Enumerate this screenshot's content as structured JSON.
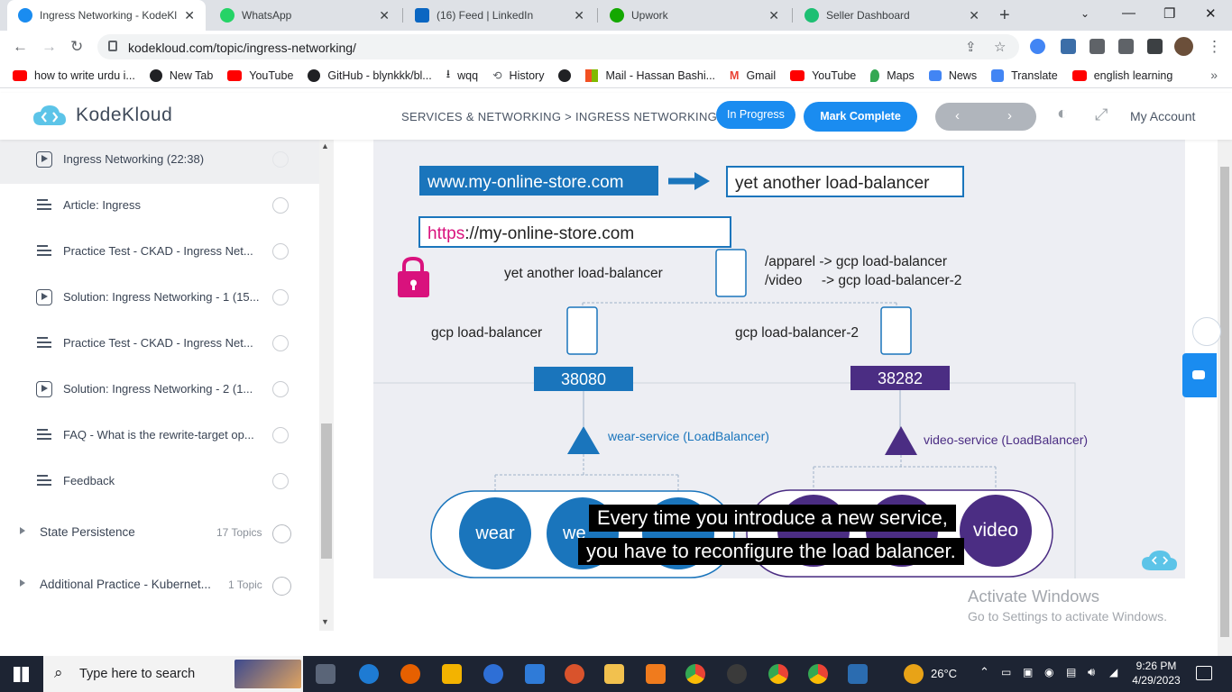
{
  "browser": {
    "tabs": [
      {
        "title": "Ingress Networking - KodeKl",
        "active": true,
        "favicon_color": "#1a8cf0"
      },
      {
        "title": "WhatsApp",
        "active": false,
        "favicon_color": "#25d366"
      },
      {
        "title": "(16) Feed | LinkedIn",
        "active": false,
        "favicon_color": "#0a66c2"
      },
      {
        "title": "Upwork",
        "active": false,
        "favicon_color": "#14a800"
      },
      {
        "title": "Seller Dashboard",
        "active": false,
        "favicon_color": "#1dbf73"
      }
    ],
    "url": "kodekloud.com/topic/ingress-networking/",
    "bookmarks": [
      {
        "label": "how to write urdu i...",
        "color": "#ff0000"
      },
      {
        "label": "New Tab",
        "color": "#202124"
      },
      {
        "label": "YouTube",
        "color": "#ff0000"
      },
      {
        "label": "GitHub - blynkkk/bl...",
        "color": "#202124"
      },
      {
        "label": "wqq",
        "color": "#202124"
      },
      {
        "label": "History",
        "color": "#5f6368"
      },
      {
        "label": "",
        "color": "#202124"
      },
      {
        "label": "Mail - Hassan Bashi...",
        "color": "#f25022"
      },
      {
        "label": "Gmail",
        "color": "#ea4335"
      },
      {
        "label": "YouTube",
        "color": "#ff0000"
      },
      {
        "label": "Maps",
        "color": "#34a853"
      },
      {
        "label": "News",
        "color": "#4285f4"
      },
      {
        "label": "Translate",
        "color": "#4285f4"
      },
      {
        "label": "english learning",
        "color": "#ff0000"
      }
    ]
  },
  "header": {
    "logo": "KodeKloud",
    "breadcrumb": "SERVICES & NETWORKING > INGRESS NETWORKING",
    "status_button": "In Progress",
    "complete_button": "Mark Complete",
    "account": "My Account",
    "accent": "#1a8cf0"
  },
  "sidebar": {
    "lessons": [
      {
        "type": "video",
        "title": "Ingress Networking (22:38)",
        "current": true
      },
      {
        "type": "doc",
        "title": "Article: Ingress",
        "current": false
      },
      {
        "type": "doc",
        "title": "Practice Test - CKAD - Ingress Net...",
        "current": false
      },
      {
        "type": "video",
        "title": "Solution: Ingress Networking - 1 (15...",
        "current": false
      },
      {
        "type": "doc",
        "title": "Practice Test - CKAD - Ingress Net...",
        "current": false
      },
      {
        "type": "video",
        "title": "Solution: Ingress Networking - 2 (1...",
        "current": false
      },
      {
        "type": "doc",
        "title": "FAQ - What is the rewrite-target op...",
        "current": false
      },
      {
        "type": "doc",
        "title": "Feedback",
        "current": false
      }
    ],
    "sections": [
      {
        "title": "State Persistence",
        "count": "17 Topics"
      },
      {
        "title": "Additional Practice - Kubernet...",
        "count": "1 Topic"
      }
    ]
  },
  "video": {
    "url_box": "www.my-online-store.com",
    "lb_box": "yet another load-balancer",
    "https_prefix": "https",
    "https_rest": "://my-online-store.com",
    "lb_label": "yet another load-balancer",
    "rule1": "/apparel -> gcp load-balancer",
    "rule2": "/video     -> gcp load-balancer-2",
    "gcp1": "gcp load-balancer",
    "gcp2": "gcp load-balancer-2",
    "port1": "38080",
    "port2": "38282",
    "svc1": "wear-service (LoadBalancer)",
    "svc2": "video-service (LoadBalancer)",
    "pod_wear": "wear",
    "pod_wear2": "we",
    "pod_video": "video",
    "subtitle_line1": "Every time you introduce a new service,",
    "subtitle_line2": "you have to reconfigure the load balancer.",
    "colors": {
      "blue": "#1a75bc",
      "purple": "#4b2d83",
      "pink": "#d9127d"
    }
  },
  "watermark": {
    "line1": "Activate Windows",
    "line2": "Go to Settings to activate Windows."
  },
  "taskbar": {
    "search_placeholder": "Type here to search",
    "temperature": "26°C",
    "time": "9:26 PM",
    "date": "4/29/2023"
  }
}
